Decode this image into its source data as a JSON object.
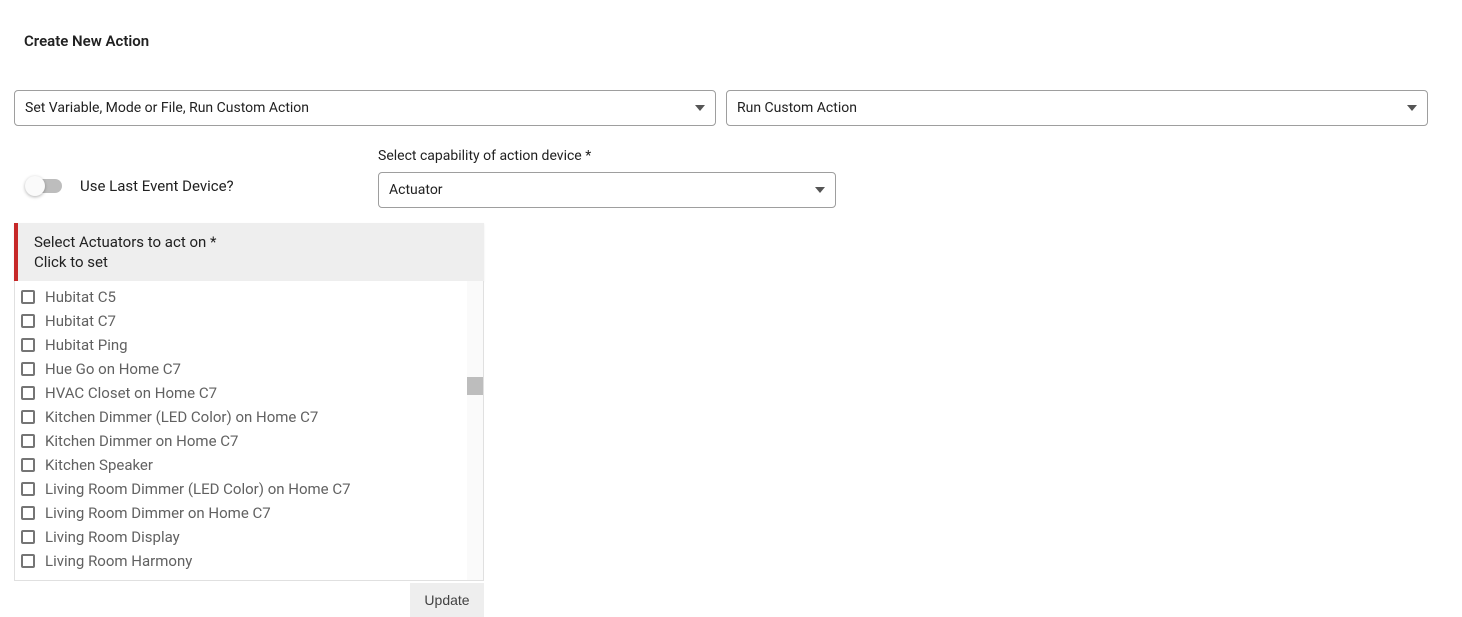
{
  "header": {
    "title": "Create New Action"
  },
  "actionTypeSelect": {
    "value": "Set Variable, Mode or File, Run Custom Action"
  },
  "actionSubSelect": {
    "value": "Run Custom Action"
  },
  "toggle": {
    "label": "Use Last Event Device?",
    "on": false
  },
  "capability": {
    "label": "Select capability of action device *",
    "value": "Actuator"
  },
  "actuatorPanel": {
    "title": "Select Actuators to act on *",
    "subtitle": "Click to set",
    "items": [
      "Hubitat C5",
      "Hubitat C7",
      "Hubitat Ping",
      "Hue Go on Home C7",
      "HVAC Closet on Home C7",
      "Kitchen Dimmer (LED Color) on Home C7",
      "Kitchen Dimmer on Home C7",
      "Kitchen Speaker",
      "Living Room Dimmer (LED Color) on Home C7",
      "Living Room Dimmer on Home C7",
      "Living Room Display",
      "Living Room Harmony"
    ]
  },
  "buttons": {
    "update": "Update"
  }
}
